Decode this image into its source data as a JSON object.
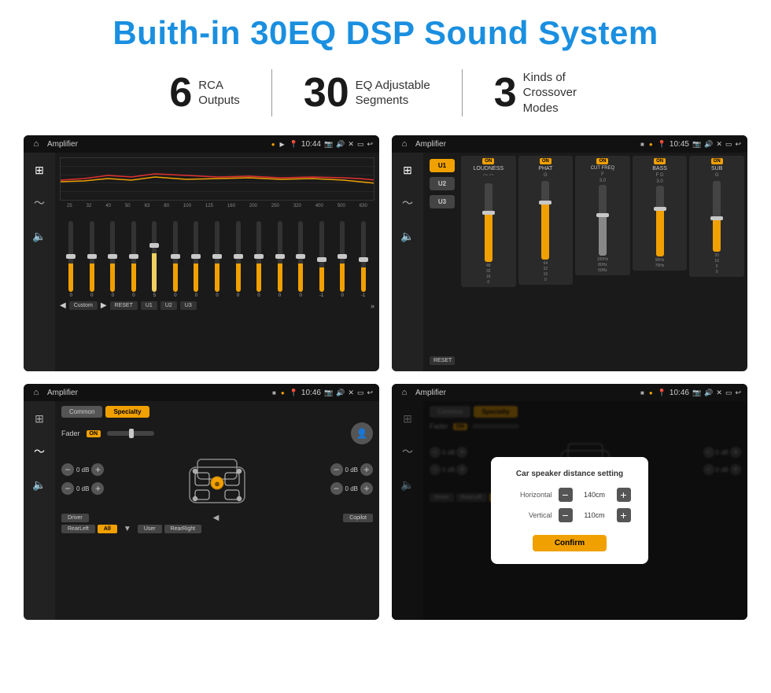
{
  "header": {
    "main_title": "Buith-in 30EQ DSP Sound System"
  },
  "stats": [
    {
      "number": "6",
      "label": "RCA\nOutputs"
    },
    {
      "number": "30",
      "label": "EQ Adjustable\nSegments"
    },
    {
      "number": "3",
      "label": "Kinds of\nCrossover Modes"
    }
  ],
  "screens": [
    {
      "id": "eq-screen",
      "title": "Amplifier",
      "time": "10:44",
      "type": "eq"
    },
    {
      "id": "crossover-screen",
      "title": "Amplifier",
      "time": "10:45",
      "type": "crossover"
    },
    {
      "id": "fader-screen",
      "title": "Amplifier",
      "time": "10:46",
      "type": "fader"
    },
    {
      "id": "distance-screen",
      "title": "Amplifier",
      "time": "10:46",
      "type": "distance"
    }
  ],
  "eq": {
    "frequencies": [
      "25",
      "32",
      "40",
      "50",
      "63",
      "80",
      "100",
      "125",
      "160",
      "200",
      "250",
      "320",
      "400",
      "500",
      "630"
    ],
    "values": [
      "0",
      "0",
      "0",
      "0",
      "5",
      "0",
      "0",
      "0",
      "0",
      "0",
      "0",
      "0",
      "-1",
      "0",
      "-1"
    ],
    "preset_label": "Custom",
    "buttons": [
      "RESET",
      "U1",
      "U2",
      "U3"
    ]
  },
  "crossover": {
    "presets": [
      "U1",
      "U2",
      "U3"
    ],
    "modules": [
      "LOUDNESS",
      "PHAT",
      "CUT FREQ",
      "BASS",
      "SUB"
    ],
    "reset_label": "RESET"
  },
  "fader": {
    "tabs": [
      "Common",
      "Specialty"
    ],
    "active_tab": "Specialty",
    "fader_label": "Fader",
    "fader_on": "ON",
    "zones": [
      "Driver",
      "RearLeft",
      "All",
      "User",
      "RearRight",
      "Copilot"
    ],
    "vol_labels": [
      "0 dB",
      "0 dB",
      "0 dB",
      "0 dB"
    ]
  },
  "distance_dialog": {
    "title": "Car speaker distance setting",
    "horizontal_label": "Horizontal",
    "horizontal_value": "140cm",
    "vertical_label": "Vertical",
    "vertical_value": "110cm",
    "confirm_label": "Confirm"
  }
}
